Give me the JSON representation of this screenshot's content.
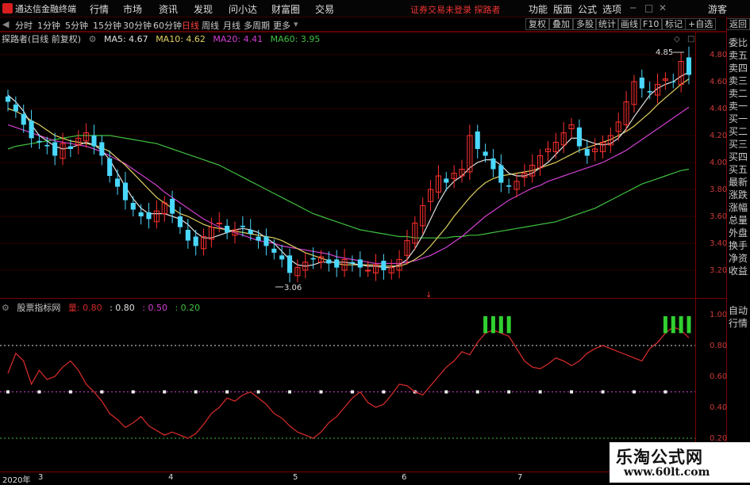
{
  "app": {
    "name": "通达信金融终端"
  },
  "menu": [
    "行情",
    "市场",
    "资讯",
    "发现",
    "问小达",
    "财富圈",
    "交易"
  ],
  "menu_right": [
    "功能",
    "版面",
    "公式",
    "选项"
  ],
  "status_text": "证券交易未登录  探路者",
  "guest": "游客",
  "periods": [
    "分时",
    "1分钟",
    "5分钟",
    "15分钟",
    "30分钟",
    "60分钟",
    "日线",
    "周线",
    "月线",
    "多周期",
    "更多"
  ],
  "active_period": "日线",
  "toolbar_right": [
    "复权",
    "叠加",
    "多股",
    "统计",
    "画线",
    "F10",
    "标记",
    "+自选",
    "返回"
  ],
  "main": {
    "title": "探路者(日线 前复权)",
    "ma5": "MA5: 4.67",
    "ma10": "MA10: 4.62",
    "ma20": "MA20: 4.41",
    "ma60": "MA60: 3.95",
    "y_labels": [
      "4.80",
      "4.60",
      "4.40",
      "4.20",
      "4.00",
      "3.80",
      "3.60",
      "3.40",
      "3.20"
    ],
    "high_label": "4.85",
    "low_label": "3.06",
    "bottom_marker": "↓"
  },
  "sub": {
    "title": "股票指标网",
    "v1": "量: 0.80",
    "v2": ": 0.80",
    "v3": ": 0.50",
    "v4": ": 0.20",
    "y_labels": [
      "1.00",
      "0.80",
      "0.60",
      "0.40",
      "0.20"
    ]
  },
  "side_main": [
    "委比",
    "卖五",
    "卖四",
    "卖三",
    "卖二",
    "卖一",
    "买一",
    "买二",
    "买三",
    "买四",
    "买五",
    "最新",
    "涨跌",
    "涨幅",
    "总量",
    "外盘",
    "换手",
    "净资",
    "收益"
  ],
  "side_sub": [
    "自动",
    "行情"
  ],
  "dates": [
    "2020年",
    "3",
    "4",
    "5",
    "6",
    "7"
  ],
  "watermark": {
    "line1": "乐淘公式网",
    "line2": "www.60lt.com"
  },
  "colors": {
    "up": "#ff3030",
    "down": "#4ad8ff",
    "ma5": "#e0e0e0",
    "ma10": "#e0d060",
    "ma20": "#d040d0",
    "ma60": "#40c040",
    "osc": "#d02a2a",
    "signal": "#30d030"
  },
  "chart_data": {
    "type": "candlestick",
    "y_range": [
      3.06,
      4.85
    ],
    "close": [
      4.45,
      4.38,
      4.28,
      4.18,
      4.15,
      4.12,
      4.05,
      4.14,
      4.1,
      4.18,
      4.22,
      4.12,
      4.05,
      3.9,
      3.82,
      3.72,
      3.65,
      3.6,
      3.58,
      3.64,
      3.7,
      3.62,
      3.52,
      3.42,
      3.38,
      3.45,
      3.52,
      3.55,
      3.48,
      3.5,
      3.52,
      3.47,
      3.42,
      3.38,
      3.33,
      3.28,
      3.18,
      3.22,
      3.26,
      3.28,
      3.3,
      3.25,
      3.22,
      3.28,
      3.25,
      3.22,
      3.2,
      3.24,
      3.2,
      3.22,
      3.28,
      3.42,
      3.55,
      3.68,
      3.8,
      3.9,
      3.85,
      3.92,
      3.95,
      4.2,
      4.1,
      4.05,
      3.95,
      3.85,
      3.82,
      3.86,
      3.92,
      3.98,
      4.05,
      4.1,
      4.15,
      4.22,
      4.28,
      4.12,
      4.05,
      4.1,
      4.15,
      4.2,
      4.3,
      4.45,
      4.6,
      4.55,
      4.52,
      4.58,
      4.62,
      4.6,
      4.75,
      4.65
    ],
    "ma5": [
      4.5,
      4.45,
      4.38,
      4.28,
      4.2,
      4.16,
      4.12,
      4.1,
      4.11,
      4.13,
      4.15,
      4.13,
      4.09,
      4.02,
      3.92,
      3.82,
      3.73,
      3.66,
      3.62,
      3.62,
      3.62,
      3.6,
      3.58,
      3.54,
      3.48,
      3.44,
      3.44,
      3.46,
      3.48,
      3.5,
      3.51,
      3.5,
      3.48,
      3.44,
      3.4,
      3.34,
      3.28,
      3.24,
      3.23,
      3.24,
      3.26,
      3.26,
      3.26,
      3.26,
      3.25,
      3.24,
      3.23,
      3.23,
      3.22,
      3.22,
      3.24,
      3.28,
      3.36,
      3.46,
      3.58,
      3.7,
      3.8,
      3.86,
      3.9,
      3.96,
      4.0,
      4.02,
      4.02,
      3.98,
      3.92,
      3.9,
      3.9,
      3.92,
      3.96,
      4.0,
      4.06,
      4.12,
      4.18,
      4.18,
      4.16,
      4.14,
      4.13,
      4.14,
      4.18,
      4.25,
      4.34,
      4.42,
      4.5,
      4.55,
      4.58,
      4.6,
      4.64,
      4.67
    ],
    "ma10": [
      4.4,
      4.38,
      4.35,
      4.31,
      4.28,
      4.24,
      4.2,
      4.18,
      4.16,
      4.15,
      4.14,
      4.13,
      4.11,
      4.08,
      4.03,
      3.98,
      3.92,
      3.86,
      3.8,
      3.74,
      3.7,
      3.66,
      3.62,
      3.6,
      3.57,
      3.54,
      3.52,
      3.51,
      3.5,
      3.49,
      3.48,
      3.47,
      3.46,
      3.45,
      3.44,
      3.42,
      3.39,
      3.36,
      3.33,
      3.31,
      3.29,
      3.27,
      3.25,
      3.24,
      3.24,
      3.24,
      3.24,
      3.24,
      3.23,
      3.23,
      3.23,
      3.25,
      3.28,
      3.32,
      3.38,
      3.45,
      3.52,
      3.6,
      3.67,
      3.74,
      3.8,
      3.85,
      3.88,
      3.9,
      3.91,
      3.92,
      3.93,
      3.94,
      3.96,
      3.98,
      4.0,
      4.03,
      4.06,
      4.09,
      4.11,
      4.13,
      4.15,
      4.17,
      4.2,
      4.23,
      4.27,
      4.32,
      4.37,
      4.43,
      4.48,
      4.53,
      4.58,
      4.62
    ],
    "ma20": [
      4.28,
      4.26,
      4.24,
      4.22,
      4.2,
      4.18,
      4.16,
      4.15,
      4.14,
      4.13,
      4.12,
      4.1,
      4.08,
      4.05,
      4.02,
      3.99,
      3.95,
      3.91,
      3.87,
      3.83,
      3.78,
      3.74,
      3.7,
      3.66,
      3.62,
      3.58,
      3.55,
      3.52,
      3.5,
      3.48,
      3.46,
      3.44,
      3.42,
      3.41,
      3.4,
      3.38,
      3.37,
      3.36,
      3.35,
      3.34,
      3.33,
      3.32,
      3.3,
      3.29,
      3.28,
      3.27,
      3.26,
      3.25,
      3.25,
      3.25,
      3.25,
      3.26,
      3.27,
      3.29,
      3.31,
      3.34,
      3.37,
      3.41,
      3.45,
      3.5,
      3.55,
      3.6,
      3.64,
      3.68,
      3.72,
      3.75,
      3.78,
      3.81,
      3.83,
      3.86,
      3.88,
      3.9,
      3.92,
      3.94,
      3.96,
      3.98,
      4.0,
      4.03,
      4.06,
      4.09,
      4.13,
      4.17,
      4.21,
      4.25,
      4.29,
      4.33,
      4.37,
      4.41
    ],
    "ma60": [
      4.1,
      4.12,
      4.13,
      4.14,
      4.15,
      4.16,
      4.17,
      4.18,
      4.19,
      4.2,
      4.2,
      4.2,
      4.2,
      4.2,
      4.19,
      4.18,
      4.17,
      4.16,
      4.15,
      4.14,
      4.12,
      4.1,
      4.08,
      4.06,
      4.04,
      4.02,
      4.0,
      3.98,
      3.95,
      3.92,
      3.89,
      3.86,
      3.83,
      3.8,
      3.77,
      3.74,
      3.71,
      3.68,
      3.65,
      3.62,
      3.6,
      3.58,
      3.56,
      3.54,
      3.52,
      3.5,
      3.49,
      3.48,
      3.47,
      3.46,
      3.45,
      3.45,
      3.44,
      3.44,
      3.44,
      3.44,
      3.44,
      3.45,
      3.45,
      3.46,
      3.46,
      3.47,
      3.48,
      3.49,
      3.5,
      3.51,
      3.52,
      3.53,
      3.54,
      3.55,
      3.56,
      3.58,
      3.6,
      3.62,
      3.64,
      3.66,
      3.69,
      3.72,
      3.75,
      3.78,
      3.81,
      3.84,
      3.86,
      3.88,
      3.9,
      3.92,
      3.94,
      3.95
    ],
    "oscillator": [
      0.62,
      0.75,
      0.7,
      0.55,
      0.64,
      0.58,
      0.6,
      0.66,
      0.7,
      0.64,
      0.55,
      0.5,
      0.44,
      0.36,
      0.32,
      0.27,
      0.3,
      0.34,
      0.28,
      0.25,
      0.22,
      0.24,
      0.22,
      0.2,
      0.23,
      0.29,
      0.36,
      0.4,
      0.46,
      0.44,
      0.48,
      0.5,
      0.46,
      0.42,
      0.36,
      0.33,
      0.28,
      0.24,
      0.22,
      0.2,
      0.24,
      0.3,
      0.34,
      0.4,
      0.46,
      0.5,
      0.43,
      0.4,
      0.42,
      0.48,
      0.55,
      0.54,
      0.5,
      0.48,
      0.54,
      0.6,
      0.66,
      0.7,
      0.76,
      0.74,
      0.82,
      0.88,
      0.9,
      0.88,
      0.86,
      0.78,
      0.7,
      0.66,
      0.65,
      0.68,
      0.72,
      0.7,
      0.67,
      0.7,
      0.75,
      0.78,
      0.8,
      0.78,
      0.76,
      0.74,
      0.72,
      0.7,
      0.78,
      0.82,
      0.88,
      0.92,
      0.9,
      0.85
    ],
    "osc_levels": [
      0.8,
      0.5,
      0.2
    ],
    "osc_range": [
      0.12,
      1.05
    ]
  }
}
